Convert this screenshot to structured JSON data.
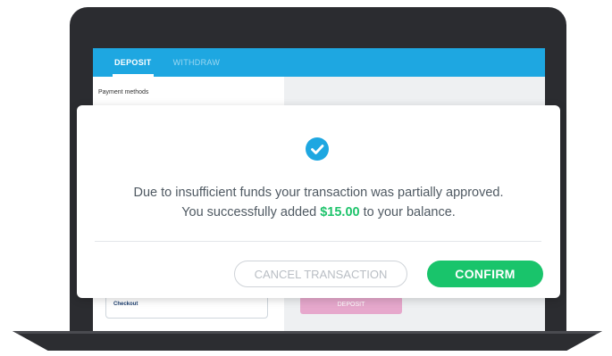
{
  "tabs": [
    {
      "label": "DEPOSIT",
      "active": true
    },
    {
      "label": "WITHDRAW",
      "active": false
    }
  ],
  "payment_methods_label": "Payment methods",
  "checkout_label": "Checkout",
  "background_deposit_label": "DEPOSIT",
  "modal": {
    "icon": "check-circle-icon",
    "message_line1": "Due to insufficient funds your transaction was partially approved.",
    "message_line2_prefix": "You successfully added ",
    "amount": "$15.00",
    "message_line2_suffix": " to your balance.",
    "cancel_label": "CANCEL TRANSACTION",
    "confirm_label": "CONFIRM"
  },
  "colors": {
    "tab_bar": "#1ea7e1",
    "confirm": "#19c46b",
    "amount": "#1ec36b",
    "check_icon": "#1ea7e1"
  }
}
